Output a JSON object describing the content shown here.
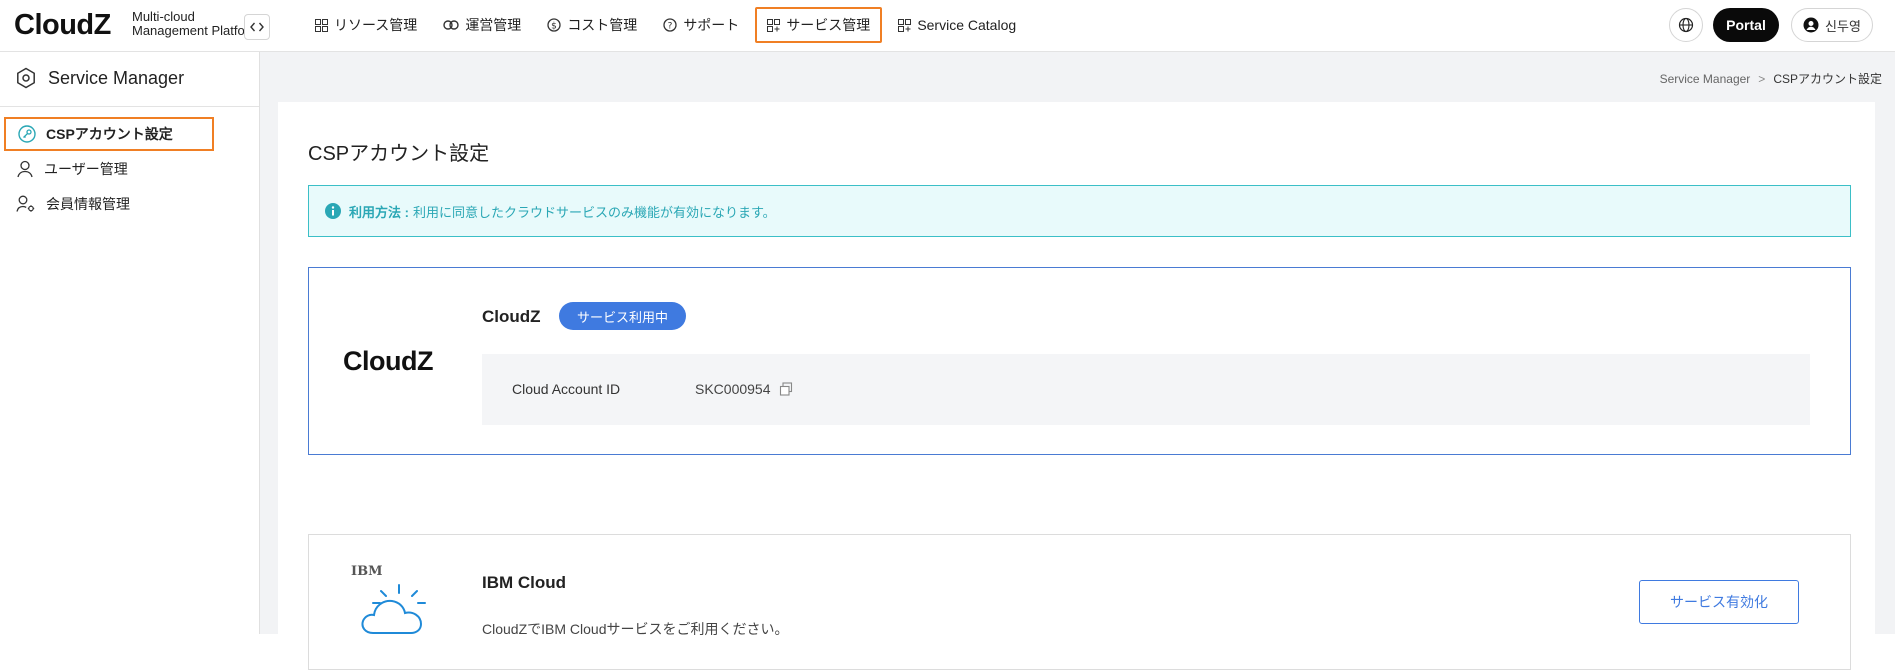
{
  "header": {
    "logo": "CloudZ",
    "tagline_line1": "Multi-cloud",
    "tagline_line2": "Management Platform",
    "nav": [
      {
        "label": "リソース管理",
        "icon": "grid-icon"
      },
      {
        "label": "運営管理",
        "icon": "link-icon"
      },
      {
        "label": "コスト管理",
        "icon": "dollar-icon"
      },
      {
        "label": "サポート",
        "icon": "help-icon"
      },
      {
        "label": "サービス管理",
        "icon": "grid-plus-icon",
        "active": true
      },
      {
        "label": "Service Catalog",
        "icon": "grid-plus-icon"
      }
    ],
    "portal_label": "Portal",
    "user_name": "신두영"
  },
  "sidebar": {
    "title": "Service Manager",
    "items": [
      {
        "label": "CSPアカウント設定",
        "icon": "key-icon",
        "active": true
      },
      {
        "label": "ユーザー管理",
        "icon": "user-icon"
      },
      {
        "label": "会員情報管理",
        "icon": "user-settings-icon"
      }
    ]
  },
  "breadcrumb": {
    "root": "Service Manager",
    "separator": ">",
    "current": "CSPアカウント設定"
  },
  "page": {
    "title": "CSPアカウント設定",
    "info_label": "利用方法 :",
    "info_text": "利用に同意したクラウドサービスのみ機能が有効になります。"
  },
  "services": {
    "cloudz": {
      "logo": "CloudZ",
      "name": "CloudZ",
      "badge": "サービス利用中",
      "account_label": "Cloud Account ID",
      "account_value": "SKC000954"
    },
    "ibm": {
      "logo_text": "IBM",
      "name": "IBM Cloud",
      "description": "CloudZでIBM Cloudサービスをご利用ください。",
      "enable_label": "サービス有効化"
    }
  },
  "colors": {
    "accent": "#3f7ae0",
    "highlight": "#f07f24",
    "info": "#2aa7b5"
  }
}
